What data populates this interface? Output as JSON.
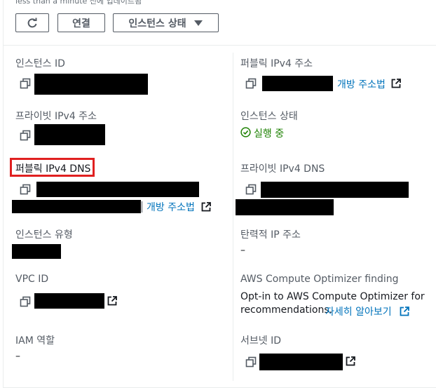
{
  "header": {
    "updated_text": "less than a minute 전에 업데이트됨",
    "connect_label": "연결",
    "state_dropdown_label": "인스턴스 상태"
  },
  "left": {
    "instance_id_label": "인스턴스 ID",
    "private_ipv4_label": "프라이빗 IPv4 주소",
    "public_ipv4_dns_label": "퍼블릭 IPv4 DNS",
    "open_address_link": "개방 주소법",
    "instance_type_label": "인스턴스 유형",
    "vpc_id_label": "VPC ID",
    "iam_role_label": "IAM 역할",
    "iam_role_value": "–"
  },
  "right": {
    "public_ipv4_label": "퍼블릭 IPv4 주소",
    "open_address_link": "개방 주소법",
    "instance_state_label": "인스턴스 상태",
    "instance_state_value": "실행 중",
    "private_ipv4_dns_label": "프라이빗 IPv4 DNS",
    "elastic_ip_label": "탄력적 IP 주소",
    "elastic_ip_value": "–",
    "optimizer_label": "AWS Compute Optimizer finding",
    "optimizer_text_1": "Opt-in to AWS Compute Optimizer for",
    "optimizer_text_2": "recommendations.",
    "optimizer_link": "자세히 알아보기",
    "subnet_id_label": "서브넷 ID"
  },
  "colors": {
    "link": "#0073bb",
    "success": "#1d8102",
    "highlight_border": "#e02020"
  }
}
